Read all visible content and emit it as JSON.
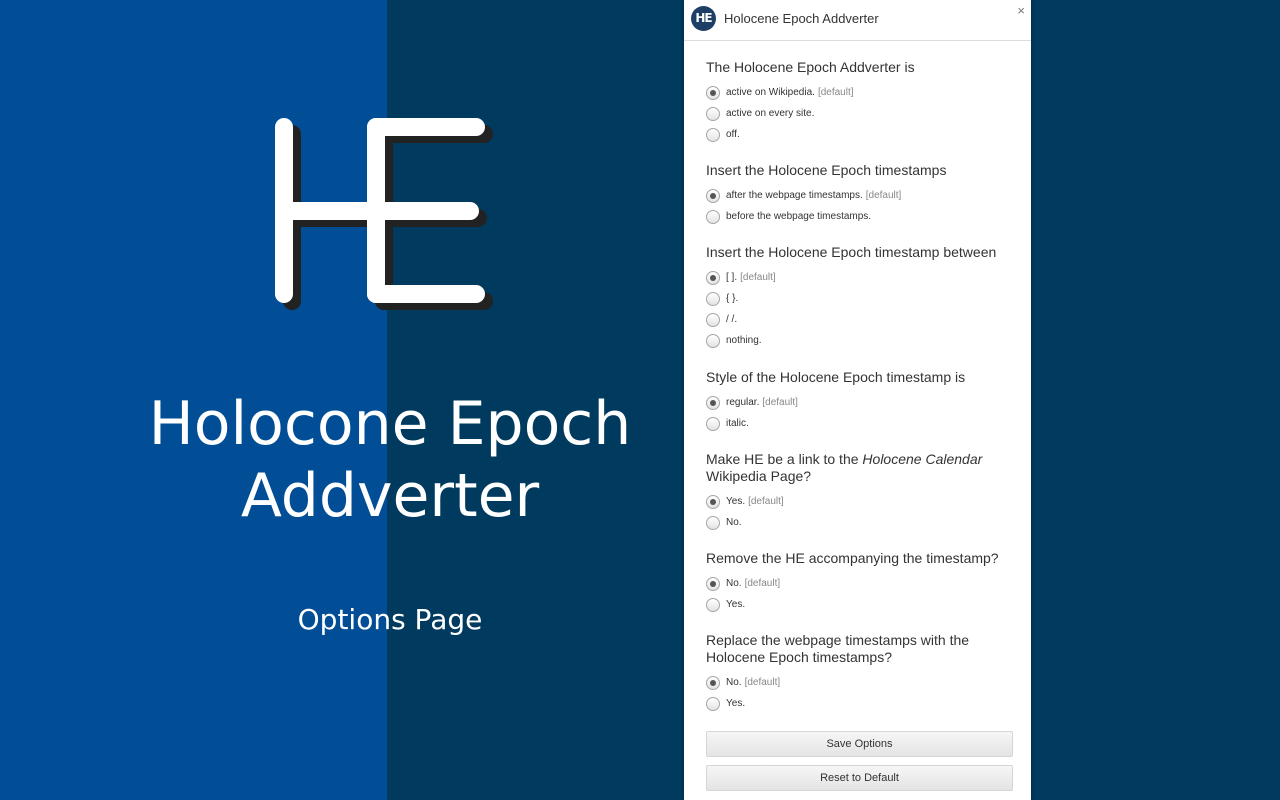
{
  "branding": {
    "title_line1": "Holocone Epoch",
    "title_line2": "Addverter",
    "subtitle": "Options Page",
    "logo_letters": "HE"
  },
  "colors": {
    "left_panel": "#024e96",
    "right_background": "#013a5f",
    "logo_header_badge": "#1d3f66"
  },
  "popup": {
    "title": "Holocene Epoch Addverter",
    "header_badge": "HE",
    "close_glyph": "×",
    "sections": [
      {
        "title": "The Holocene Epoch Addverter is",
        "options": [
          {
            "label": "active on Wikipedia.",
            "default_tag": "[default]",
            "checked": true
          },
          {
            "label": "active on every site.",
            "default_tag": "",
            "checked": false
          },
          {
            "label": "off.",
            "default_tag": "",
            "checked": false
          }
        ]
      },
      {
        "title": "Insert the Holocene Epoch timestamps",
        "options": [
          {
            "label": "after the webpage timestamps.",
            "default_tag": "[default]",
            "checked": true
          },
          {
            "label": "before the webpage timestamps.",
            "default_tag": "",
            "checked": false
          }
        ]
      },
      {
        "title": "Insert the Holocene Epoch timestamp between",
        "options": [
          {
            "label": "[ ].",
            "default_tag": "[default]",
            "checked": true
          },
          {
            "label": "{ }.",
            "default_tag": "",
            "checked": false
          },
          {
            "label": "/ /.",
            "default_tag": "",
            "checked": false
          },
          {
            "label": "nothing.",
            "default_tag": "",
            "checked": false
          }
        ]
      },
      {
        "title": "Style of the Holocene Epoch timestamp is",
        "options": [
          {
            "label": "regular.",
            "default_tag": "[default]",
            "checked": true
          },
          {
            "label": "italic.",
            "default_tag": "",
            "checked": false
          }
        ]
      },
      {
        "title_pre": "Make HE be a link to the ",
        "title_em": "Holocene Calendar",
        "title_post": " Wikipedia Page?",
        "options": [
          {
            "label": "Yes.",
            "default_tag": "[default]",
            "checked": true
          },
          {
            "label": "No.",
            "default_tag": "",
            "checked": false
          }
        ]
      },
      {
        "title": "Remove the HE accompanying the timestamp?",
        "options": [
          {
            "label": "No.",
            "default_tag": "[default]",
            "checked": true
          },
          {
            "label": "Yes.",
            "default_tag": "",
            "checked": false
          }
        ]
      },
      {
        "title": "Replace the webpage timestamps with the Holocene Epoch timestamps?",
        "options": [
          {
            "label": "No.",
            "default_tag": "[default]",
            "checked": true
          },
          {
            "label": "Yes.",
            "default_tag": "",
            "checked": false
          }
        ]
      }
    ],
    "save_button": "Save Options",
    "reset_button": "Reset to Default"
  }
}
